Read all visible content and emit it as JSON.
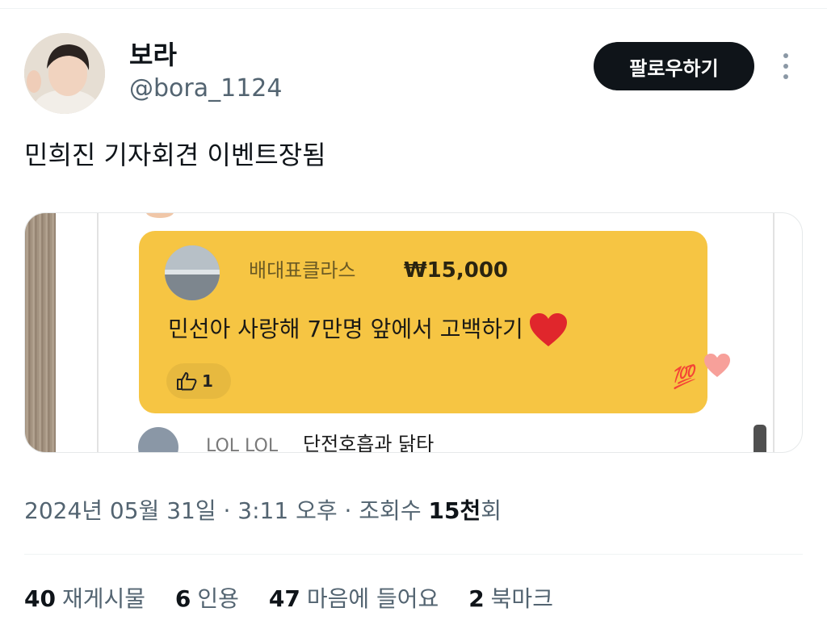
{
  "user": {
    "display_name": "보라",
    "handle": "@bora_1124"
  },
  "follow_label": "팔로우하기",
  "tweet_text": "민희진 기자회견 이벤트장됨",
  "media": {
    "superchat": {
      "name": "배대표클라스",
      "amount": "₩15,000",
      "message": "민선아 사랑해 7만명 앞에서 고백하기",
      "like_count": "1",
      "accent": "#f6c543"
    },
    "chat_row": {
      "name": "LOL LOL",
      "text": "단전호흡과 닭타"
    }
  },
  "timestamp": {
    "prefix": "2024년 05월 31일 · 3:11 오후 · 조회수 ",
    "views": "15천",
    "suffix": "회"
  },
  "stats": [
    {
      "count": "40",
      "label": "재게시물"
    },
    {
      "count": "6",
      "label": "인용"
    },
    {
      "count": "47",
      "label": "마음에 들어요"
    },
    {
      "count": "2",
      "label": "북마크"
    }
  ],
  "icons": {
    "more": "more-vertical-icon",
    "like": "thumbs-up-icon",
    "heart": "red-heart-icon",
    "hundred": "hundred-points-icon"
  }
}
